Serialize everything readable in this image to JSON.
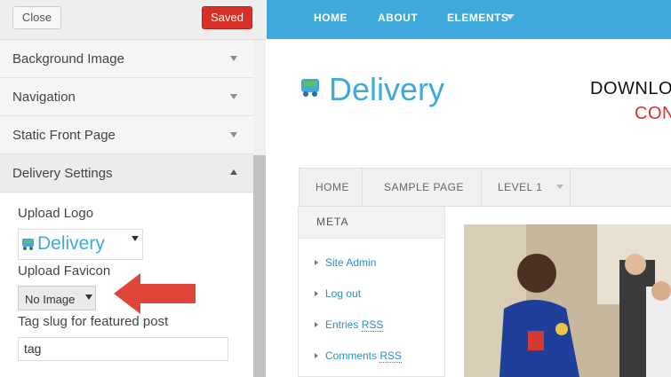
{
  "panel": {
    "close_label": "Close",
    "saved_label": "Saved",
    "sections": [
      {
        "label": "Background Image"
      },
      {
        "label": "Navigation"
      },
      {
        "label": "Static Front Page"
      },
      {
        "label": "Delivery Settings"
      }
    ],
    "upload_logo_label": "Upload Logo",
    "logo_select_text": "Delivery",
    "upload_favicon_label": "Upload Favicon",
    "favicon_select_value": "No Image",
    "tag_slug_label": "Tag slug for featured post",
    "tag_slug_value": "tag"
  },
  "preview": {
    "topnav": [
      "HOME",
      "ABOUT",
      "ELEMENTS"
    ],
    "site_title": "Delivery",
    "banner_line1": "DOWNLO",
    "banner_line2": "CON",
    "mainnav": [
      "HOME",
      "SAMPLE PAGE",
      "LEVEL 1"
    ],
    "sidebar_title": "META",
    "sidebar_links": [
      {
        "text": "Site Admin"
      },
      {
        "text": "Log out"
      },
      {
        "text_pre": "Entries ",
        "abbr": "RSS"
      },
      {
        "text_pre": "Comments ",
        "abbr": "RSS"
      }
    ]
  },
  "colors": {
    "accent": "#3fa9dc",
    "saved_button": "#d9302a",
    "arrow": "#e0453a"
  },
  "icons": {
    "logo": "truck-icon",
    "dropdown": "chevron-down-icon",
    "annotation": "red-arrow-icon"
  }
}
